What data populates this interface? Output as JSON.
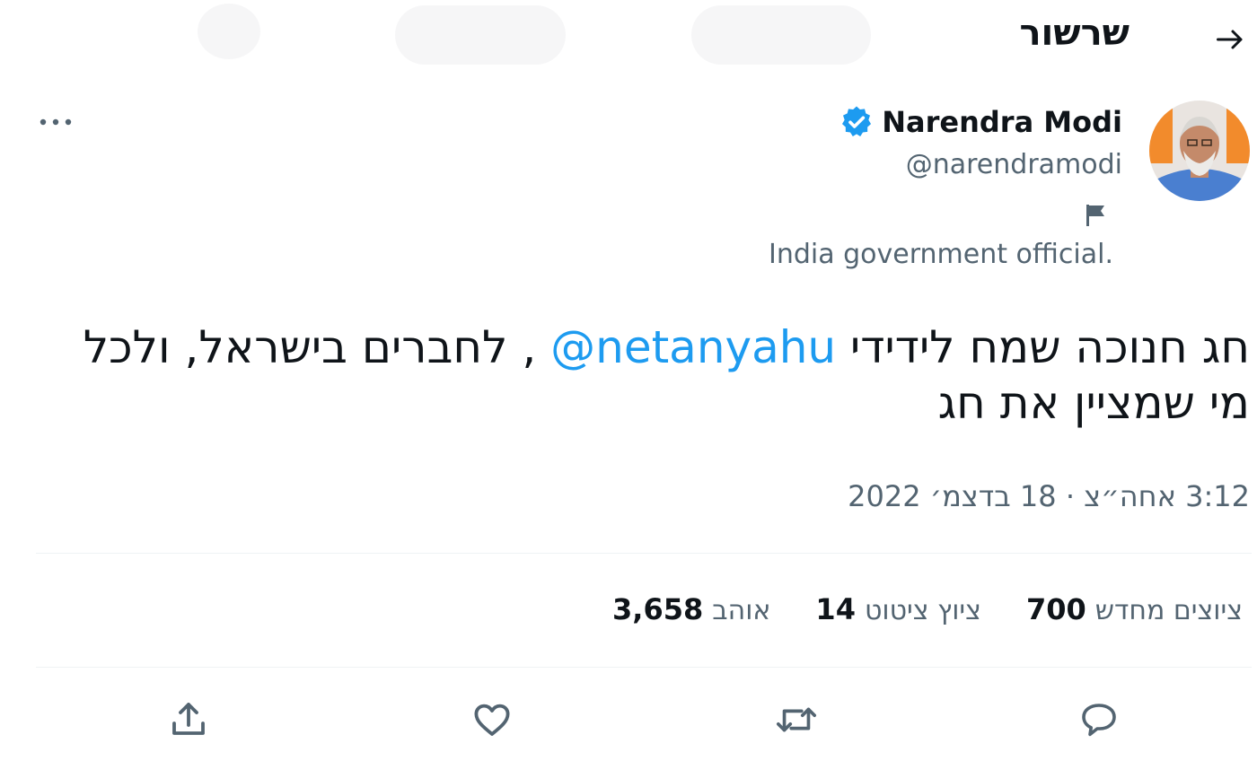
{
  "header": {
    "title": "שרשור"
  },
  "tweet": {
    "author_name": "Narendra Modi",
    "author_handle": "@narendramodi",
    "affiliation": "India government official.",
    "text_before_mention": "חג חנוכה שמח לידידי ",
    "mention": "@netanyahu",
    "text_after_mention": " , לחברים בישראל, ולכל מי שמציין את חג",
    "timestamp": "3:12 אחה״צ · 18 בדצמ׳ 2022"
  },
  "stats": {
    "retweets_count": "700",
    "retweets_label": "ציוצים מחדש",
    "quotes_count": "14",
    "quotes_label": "ציוץ ציטוט",
    "likes_count": "3,658",
    "likes_label": "אוהב"
  },
  "icons": {
    "back": "arrow-icon",
    "verified": "verified-badge-icon",
    "affiliation": "flag-icon",
    "more": "more-icon",
    "reply": "reply-icon",
    "retweet": "retweet-icon",
    "like": "heart-icon",
    "share": "share-icon"
  },
  "colors": {
    "accent": "#1d9bf0",
    "text": "#0f1419",
    "secondary_text": "#536471",
    "divider": "#eff3f4"
  }
}
